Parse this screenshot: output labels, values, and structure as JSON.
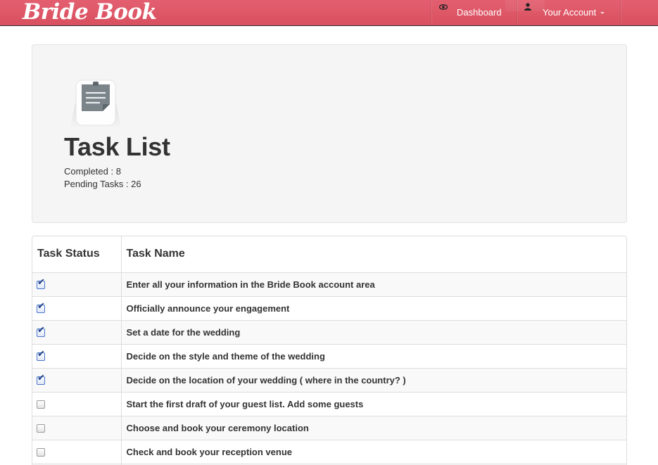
{
  "brand": {
    "name": "Bride Book"
  },
  "nav": {
    "dashboard_label": "Dashboard",
    "account_label": "Your Account",
    "dashboard_icon": "eye-icon",
    "account_icon": "user-icon"
  },
  "hero": {
    "title": "Task List",
    "completed_text": "Completed : 8",
    "pending_text": "Pending Tasks : 26",
    "icon": "notepad-icon"
  },
  "table": {
    "headers": {
      "status": "Task Status",
      "name": "Task Name"
    },
    "rows": [
      {
        "name": "Enter all your information in the Bride Book account area",
        "done": true
      },
      {
        "name": "Officially announce your engagement",
        "done": true
      },
      {
        "name": "Set a date for the wedding",
        "done": true
      },
      {
        "name": "Decide on the style and theme of the wedding",
        "done": true
      },
      {
        "name": "Decide on the location of your wedding ( where in the country? )",
        "done": true
      },
      {
        "name": "Start the first draft of your guest list. Add some guests",
        "done": false
      },
      {
        "name": "Choose and book your ceremony location",
        "done": false
      },
      {
        "name": "Check and book your reception venue",
        "done": false
      },
      {
        "name": "",
        "done": false
      }
    ]
  },
  "colors": {
    "navbar": "#de5868",
    "checkbox_checked": "#1b3f86"
  }
}
